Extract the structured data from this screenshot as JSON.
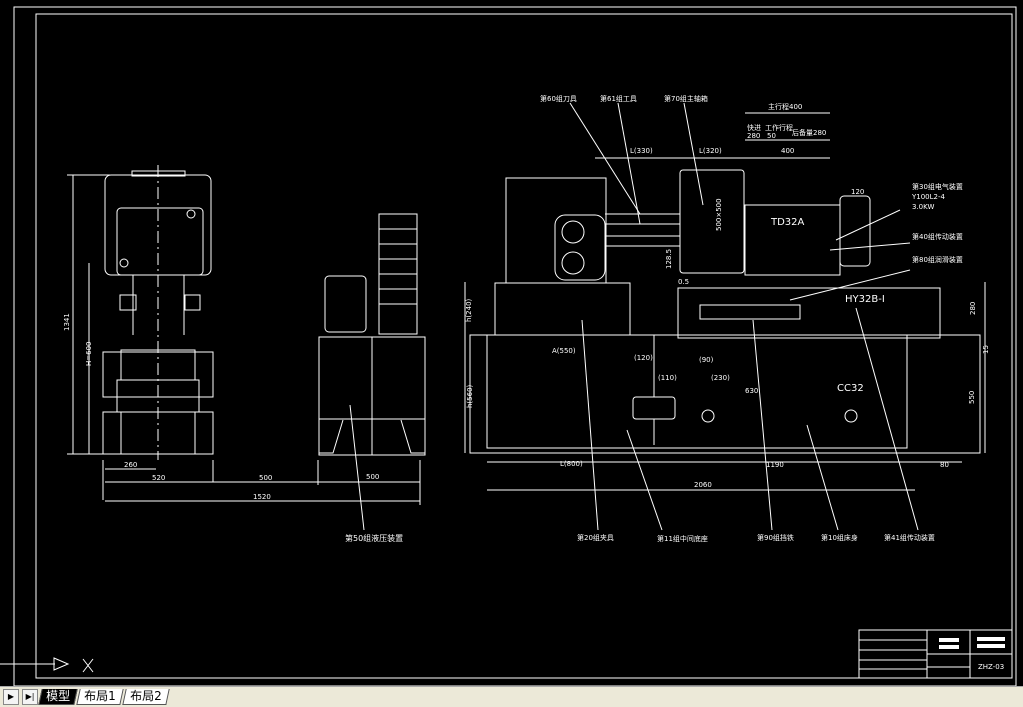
{
  "layout_tabs": [
    {
      "label": "模型",
      "active": true
    },
    {
      "label": "布局1",
      "active": false
    },
    {
      "label": "布局2",
      "active": false
    }
  ],
  "nav_icons": [
    "first-tab-icon",
    "last-tab-icon"
  ],
  "colors": {
    "background": "#000000",
    "lines": "#ffffff",
    "tabbar": "#ece9d8"
  },
  "labels": {
    "tool": "第60组刀具",
    "fixture_tool": "第61组工具",
    "spindle_box": "第70组主轴箱",
    "electrical": "第30组电气装置",
    "motor": "Y100L2-4",
    "power": "3.0KW",
    "drive40": "第40组传动装置",
    "lube": "第80组润滑装置",
    "clamp": "第20组夹具",
    "mid_base": "第11组中间底座",
    "stop": "第90组挡铁",
    "bed": "第10组床身",
    "drive41": "第41组传动装置",
    "hydraulic": "第50组液压装置"
  },
  "models": {
    "head": "TD32A",
    "slide": "HY32B-I",
    "bed": "CC32"
  },
  "dims": {
    "stroke_total": "主行程400",
    "fast_fwd": "快进",
    "fast_fwd_val": "280",
    "work_feed": "工作行程",
    "work_feed_val": "50",
    "fast_back": "后备量280",
    "l330": "L(330)",
    "l320": "L(320)",
    "d400": "400",
    "d120": "120",
    "d500_500": "500×500",
    "d128": "128.5",
    "d05": "0.5",
    "h280": "280",
    "h240": "h(240)",
    "h560": "h(560)",
    "h550": "550",
    "d15": "15",
    "a550": "A(550)",
    "d120p": "(120)",
    "d90": "(90)",
    "d110": "(110)",
    "d230": "(230)",
    "d630": "630",
    "l800": "L(800)",
    "d1190": "1190",
    "d80": "80",
    "d2060": "2060",
    "h1341": "1341",
    "h600": "H=600",
    "d260": "260",
    "d520": "520",
    "d500a": "500",
    "d500b": "500",
    "d1520": "1520"
  },
  "title_block": {
    "drawing_no": "ZHZ-03"
  }
}
